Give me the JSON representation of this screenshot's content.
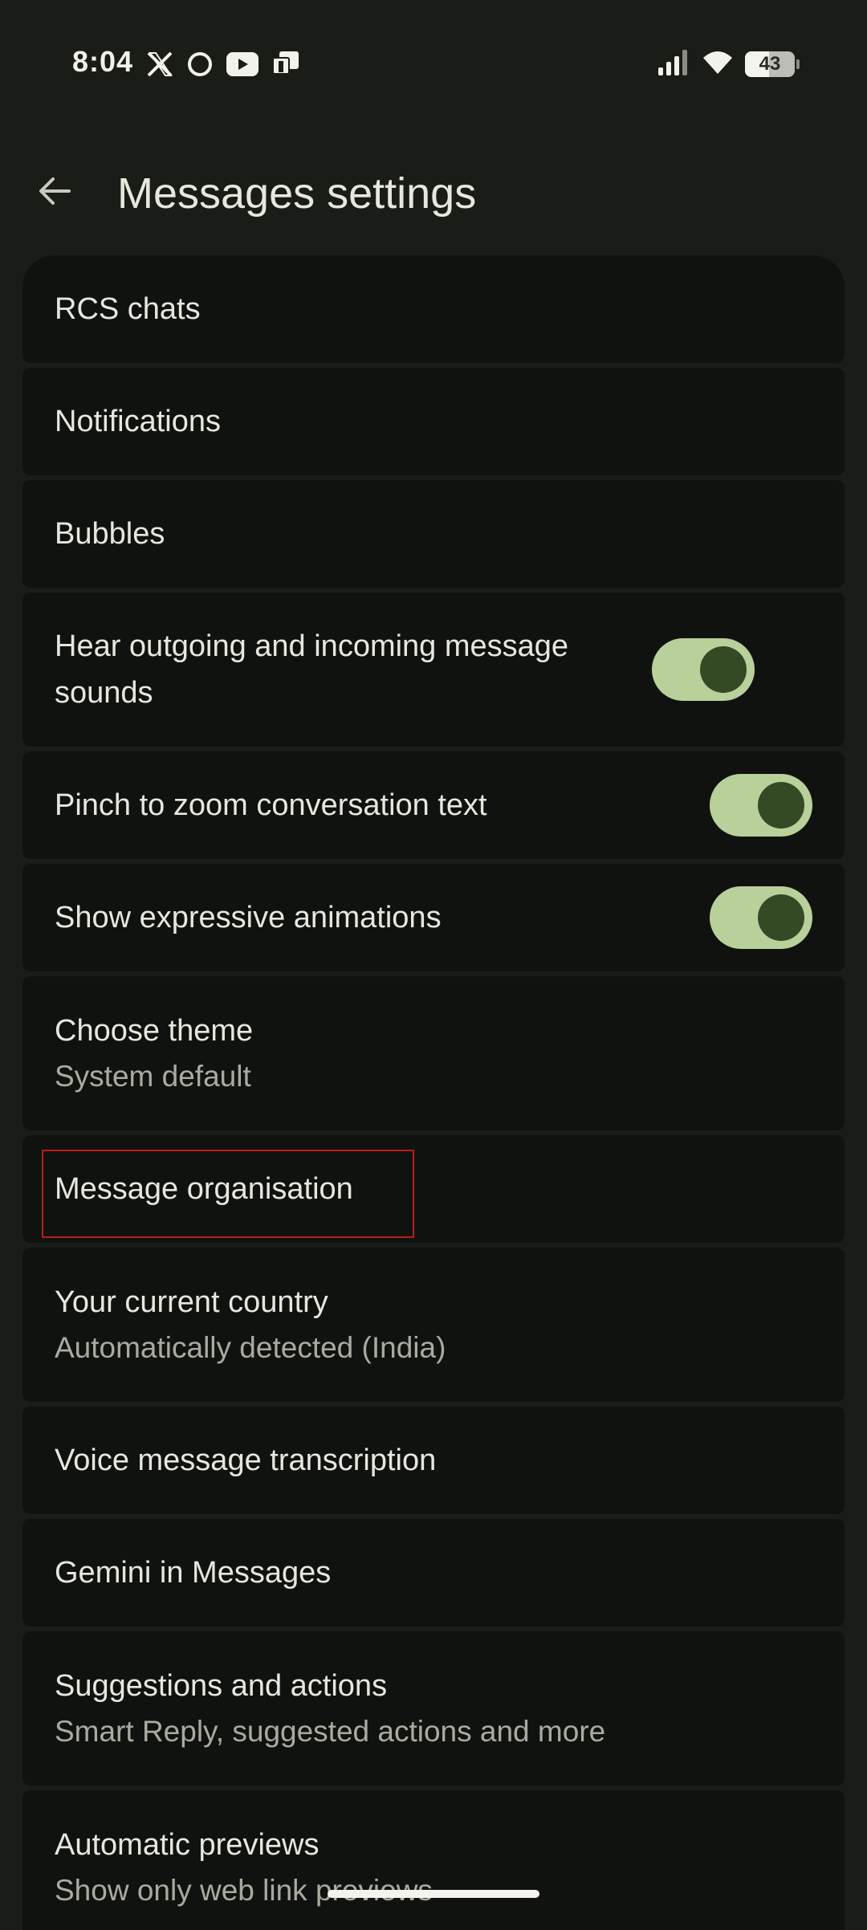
{
  "status_bar": {
    "time": "8:04",
    "notification_icons": [
      "x-icon",
      "threads-icon",
      "youtube-icon",
      "teams-icon"
    ],
    "battery_level": "43",
    "system_icons": [
      "signal-icon",
      "wifi-icon",
      "battery-icon"
    ]
  },
  "app_bar": {
    "back_icon": "arrow-left-icon",
    "title": "Messages settings"
  },
  "settings": [
    {
      "title": "RCS chats"
    },
    {
      "title": "Notifications"
    },
    {
      "title": "Bubbles"
    },
    {
      "title": "Hear outgoing and incoming message sounds",
      "toggle": true
    },
    {
      "title": "Pinch to zoom conversation text",
      "toggle": true
    },
    {
      "title": "Show expressive animations",
      "toggle": true
    },
    {
      "title": "Choose theme",
      "subtitle": "System default"
    },
    {
      "title": "Message organisation",
      "highlighted": true
    },
    {
      "title": "Your current country",
      "subtitle": "Automatically detected (India)"
    },
    {
      "title": "Voice message transcription"
    },
    {
      "title": "Gemini in Messages"
    },
    {
      "title": "Suggestions and actions",
      "subtitle": "Smart Reply, suggested actions and more"
    },
    {
      "title": "Automatic previews",
      "subtitle": "Show only web link previews"
    }
  ],
  "colors": {
    "background": "#1a1c18",
    "card": "#101210",
    "toggle_track": "#b9d09a",
    "toggle_knob": "#344a25",
    "highlight": "#c0191e"
  }
}
